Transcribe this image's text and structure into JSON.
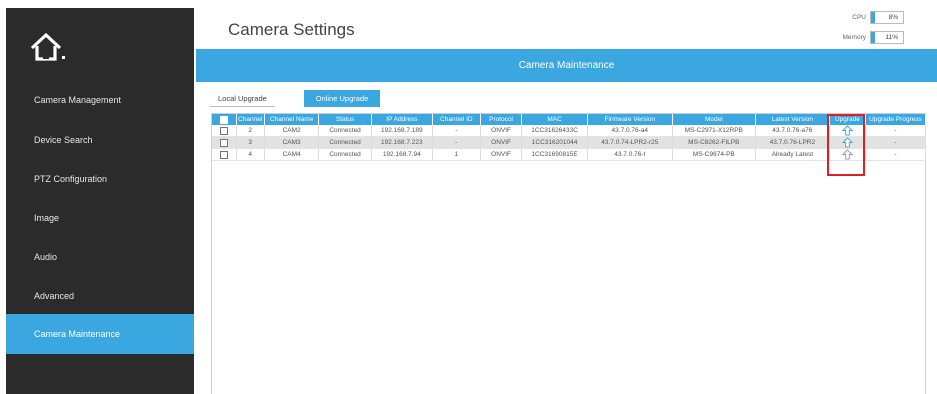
{
  "header": {
    "title": "Camera Settings",
    "cpu_label": "CPU",
    "cpu_value": "8%",
    "memory_label": "Memory",
    "memory_value": "11%"
  },
  "sidebar": {
    "items": [
      {
        "label": "Camera Management"
      },
      {
        "label": "Device Search"
      },
      {
        "label": "PTZ Configuration"
      },
      {
        "label": "Image"
      },
      {
        "label": "Audio"
      },
      {
        "label": "Advanced"
      },
      {
        "label": "Camera Maintenance",
        "active": true
      }
    ]
  },
  "banner": "Camera Maintenance",
  "tabs": {
    "local": "Local Upgrade",
    "online": "Online Upgrade"
  },
  "table": {
    "columns": [
      "Channel",
      "Channel Name",
      "Status",
      "IP Address",
      "Channel ID",
      "Protocol",
      "MAC",
      "Firmware Version",
      "Model",
      "Latest Version",
      "Upgrade",
      "Upgrade Progress"
    ],
    "rows": [
      {
        "channel": "2",
        "name": "CAM2",
        "status": "Connected",
        "ip": "192.168.7.189",
        "channel_id": "-",
        "protocol": "ONVIF",
        "mac": "1CC31626433C",
        "firmware": "43.7.0.76-a4",
        "model": "MS-C2971-X12RPB",
        "latest": "43.7.0.76-a76",
        "progress": "-"
      },
      {
        "channel": "3",
        "name": "CAM3",
        "status": "Connected",
        "ip": "192.168.7.223",
        "channel_id": "-",
        "protocol": "ONVIF",
        "mac": "1CC316201044",
        "firmware": "43.7.0.74-LPR2-r25",
        "model": "MS-C8262-FILPB",
        "latest": "43.7.0.76-LPR2",
        "progress": "-"
      },
      {
        "channel": "4",
        "name": "CAM4",
        "status": "Connected",
        "ip": "192.168.7.94",
        "channel_id": "1",
        "protocol": "ONVIF",
        "mac": "1CC31690815E",
        "firmware": "43.7.0.76-t",
        "model": "MS-C9674-PB",
        "latest": "Already Latest",
        "progress": "-"
      }
    ]
  },
  "colors": {
    "accent": "#3aa7e0",
    "sidebar_bg": "#2b2b2b",
    "highlight": "#e02020"
  },
  "icons": {
    "logo": "home-icon",
    "upgrade": "upload-arrow-icon"
  }
}
